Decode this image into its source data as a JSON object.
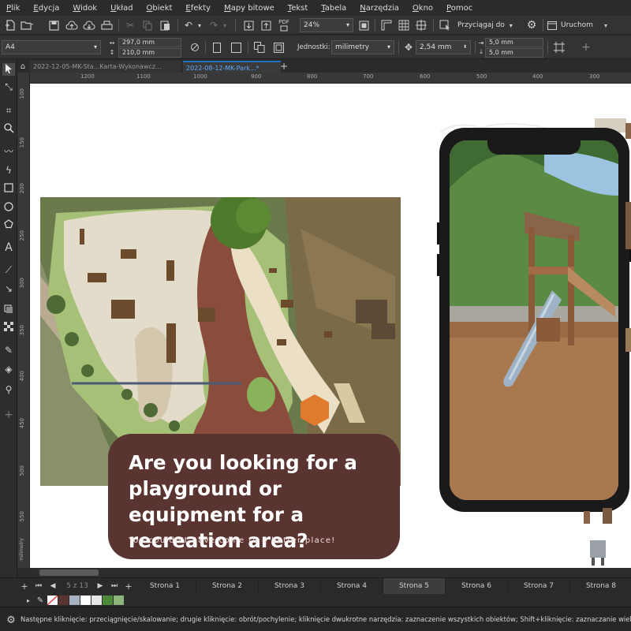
{
  "menu": [
    "Plik",
    "Edycja",
    "Widok",
    "Układ",
    "Obiekt",
    "Efekty",
    "Mapy bitowe",
    "Tekst",
    "Tabela",
    "Narzędzia",
    "Okno",
    "Pomoc"
  ],
  "toolbar": {
    "zoom": "24%",
    "snap_label": "Przyciągaj do",
    "launch_label": "Uruchom",
    "pdf_label": "PDF"
  },
  "propbar": {
    "paper_size": "A4",
    "width": "297,0 mm",
    "height": "210,0 mm",
    "units_label": "Jednostki:",
    "units_value": "milimetry",
    "nudge": "2,54 mm",
    "dup_x": "5,0 mm",
    "dup_y": "5,0 mm"
  },
  "doc_tabs": [
    "2022-12-05-MK-Sta...Karta-Wykonawcz...",
    "2022-08-12-MK-Park...*"
  ],
  "ruler_h": [
    "1200",
    "1100",
    "1000",
    "900",
    "800",
    "700",
    "600",
    "500",
    "400",
    "300"
  ],
  "ruler_v": [
    "100",
    "150",
    "200",
    "250",
    "300",
    "350",
    "400",
    "450",
    "500",
    "550"
  ],
  "ruler_unit": "milimetry",
  "cta": {
    "title": "Are you looking for a playground or equipment for a recreation area?",
    "subtitle": "You couldn't have come to a better place!"
  },
  "pager": {
    "counter": "5 z 13",
    "pages": [
      "Strona 1",
      "Strona 2",
      "Strona 3",
      "Strona 4",
      "Strona 5",
      "Strona 6",
      "Strona 7",
      "Strona 8"
    ],
    "active_index": 4
  },
  "status": {
    "text": "Następne kliknięcie: przeciągnięcie/skalowanie; drugie kliknięcie: obrót/pochylenie; kliknięcie dwukrotne narzędzia: zaznaczenie wszystkich obiektów; Shift+kliknięcie: zaznaczanie wielu obie"
  },
  "colors": {
    "cta_bg": "#5a3431",
    "app_bg": "#2b2b2b",
    "accent_tab": "#1f6fbf"
  }
}
